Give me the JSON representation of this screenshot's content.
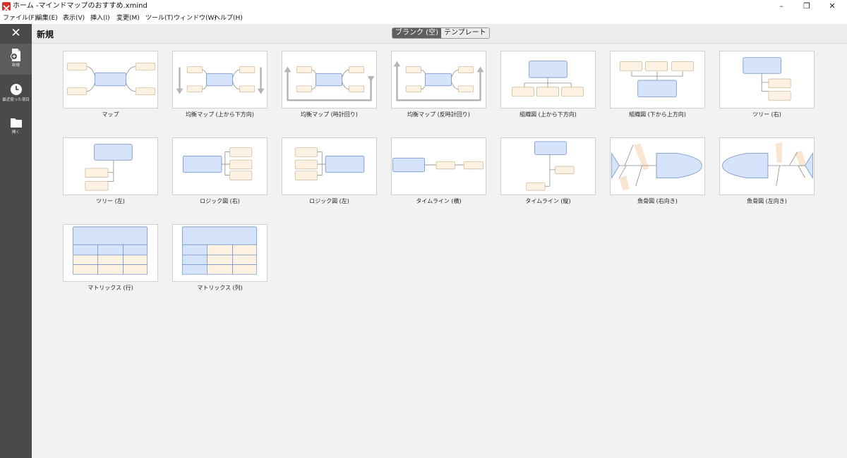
{
  "window": {
    "title": "ホーム -マインドマップのおすすめ.xmind",
    "minimize_glyph": "–",
    "restore_glyph": "❐",
    "close_glyph": "✕"
  },
  "menu": [
    "ファイル(F)",
    "編集(E)",
    "表示(V)",
    "挿入(I)",
    "変更(M)",
    "ツール(T)",
    "ウィンドウ(W)",
    "ヘルプ(H)"
  ],
  "sidebar": {
    "close_glyph": "✕",
    "items": [
      {
        "label": "新規",
        "icon": "new-file-icon"
      },
      {
        "label": "最近使った項目",
        "icon": "clock-icon"
      },
      {
        "label": "開く",
        "icon": "folder-icon"
      }
    ]
  },
  "header": {
    "title": "新規",
    "tabs": [
      {
        "label": "ブランク (空)",
        "active": true
      },
      {
        "label": "テンプレート",
        "active": false
      }
    ]
  },
  "templates": [
    {
      "label": "マップ",
      "kind": "map"
    },
    {
      "label": "均衡マップ (上から下方向)",
      "kind": "balanced-down"
    },
    {
      "label": "均衡マップ (時計回り)",
      "kind": "balanced-cw"
    },
    {
      "label": "均衡マップ (反時計回り)",
      "kind": "balanced-ccw"
    },
    {
      "label": "組織図 (上から下方向)",
      "kind": "org-down"
    },
    {
      "label": "組織図 (下から上方向)",
      "kind": "org-up"
    },
    {
      "label": "ツリー (右)",
      "kind": "tree-right"
    },
    {
      "label": "ツリー (左)",
      "kind": "tree-left"
    },
    {
      "label": "ロジック図 (右)",
      "kind": "logic-right"
    },
    {
      "label": "ロジック図 (左)",
      "kind": "logic-left"
    },
    {
      "label": "タイムライン (横)",
      "kind": "timeline-h"
    },
    {
      "label": "タイムライン (縦)",
      "kind": "timeline-v"
    },
    {
      "label": "魚骨図 (右向き)",
      "kind": "fish-right"
    },
    {
      "label": "魚骨図 (左向き)",
      "kind": "fish-left"
    },
    {
      "label": "マトリックス (行)",
      "kind": "matrix-row"
    },
    {
      "label": "マトリックス (列)",
      "kind": "matrix-col"
    }
  ],
  "colors": {
    "topic_fill": "#d5e3fb",
    "topic_stroke": "#6f8fc8",
    "sub_fill": "#fdf1e2",
    "sub_stroke": "#c9b394",
    "line": "#8a8a8a",
    "arrow": "#b4b4b4",
    "fishbone": "#f8e5d2",
    "sidebar_bg": "#4a4a4a",
    "logo": "#d9302b"
  }
}
